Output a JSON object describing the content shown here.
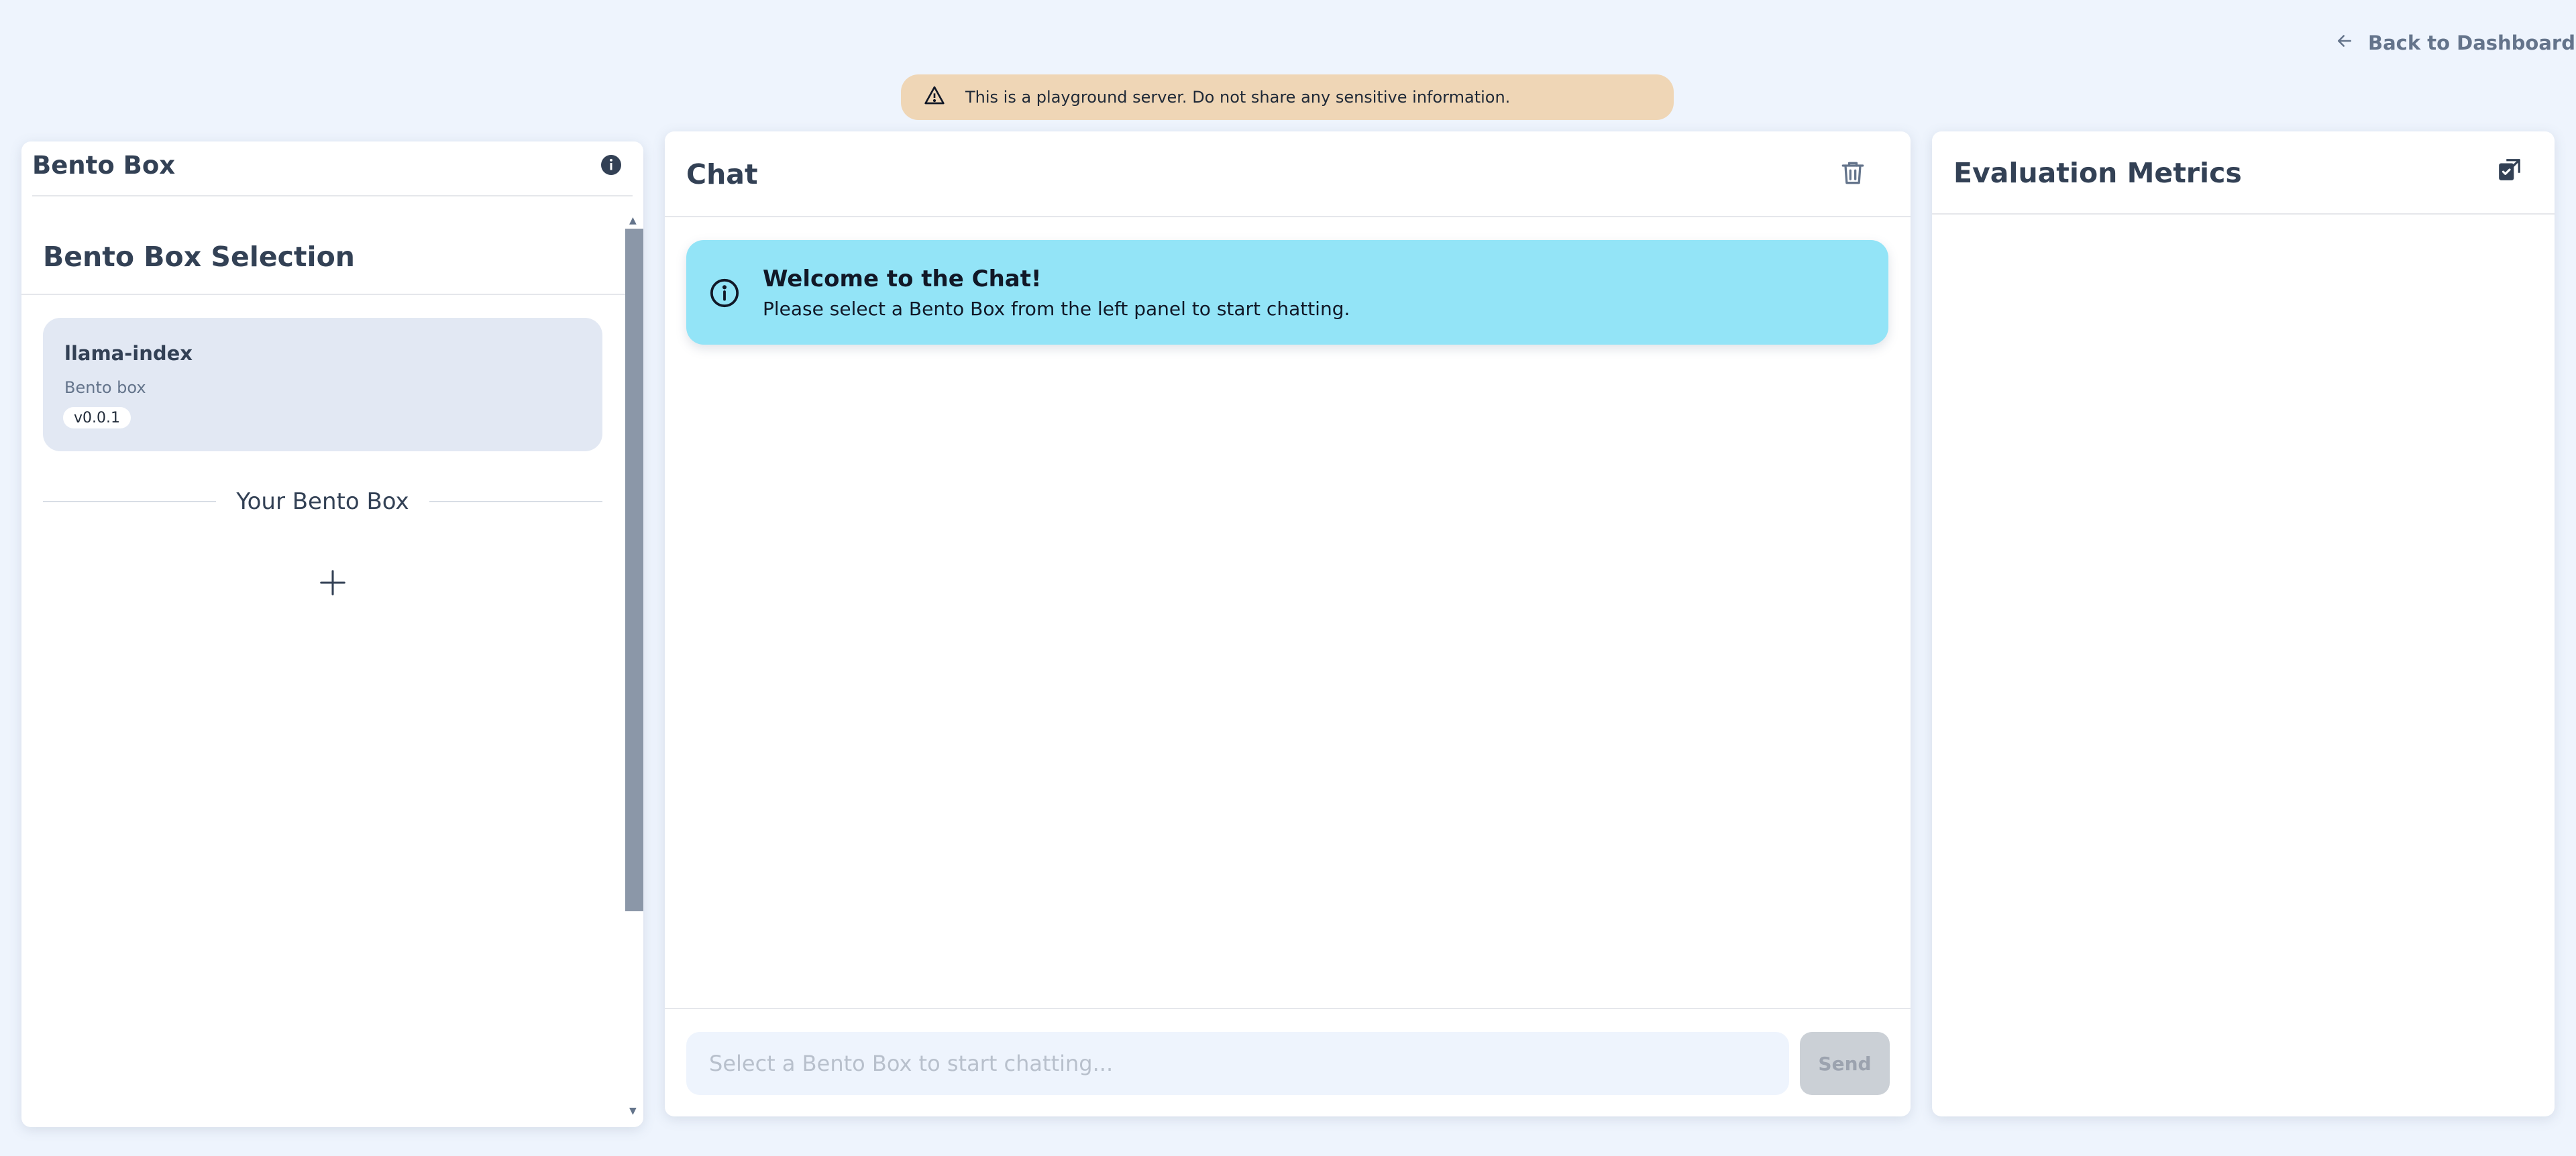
{
  "nav": {
    "back_label": "Back to Dashboard"
  },
  "banner": {
    "text": "This is a playground server. Do not share any sensitive information."
  },
  "left_panel": {
    "title": "Bento Box",
    "selection_title": "Bento Box Selection",
    "cards": [
      {
        "name": "llama-index",
        "description": "Bento box",
        "version": "v0.0.1"
      }
    ],
    "your_box_label": "Your Bento Box"
  },
  "chat": {
    "title": "Chat",
    "alert_title": "Welcome to the Chat!",
    "alert_body": "Please select a Bento Box from the left panel to start chatting.",
    "input_placeholder": "Select a Bento Box to start chatting...",
    "send_label": "Send"
  },
  "metrics": {
    "title": "Evaluation Metrics"
  },
  "colors": {
    "background": "#eef4fd",
    "warning": "#efd6b6",
    "info_alert": "#93e4f7",
    "card": "#e2e8f3",
    "text": "#334155",
    "muted": "#64748b"
  }
}
